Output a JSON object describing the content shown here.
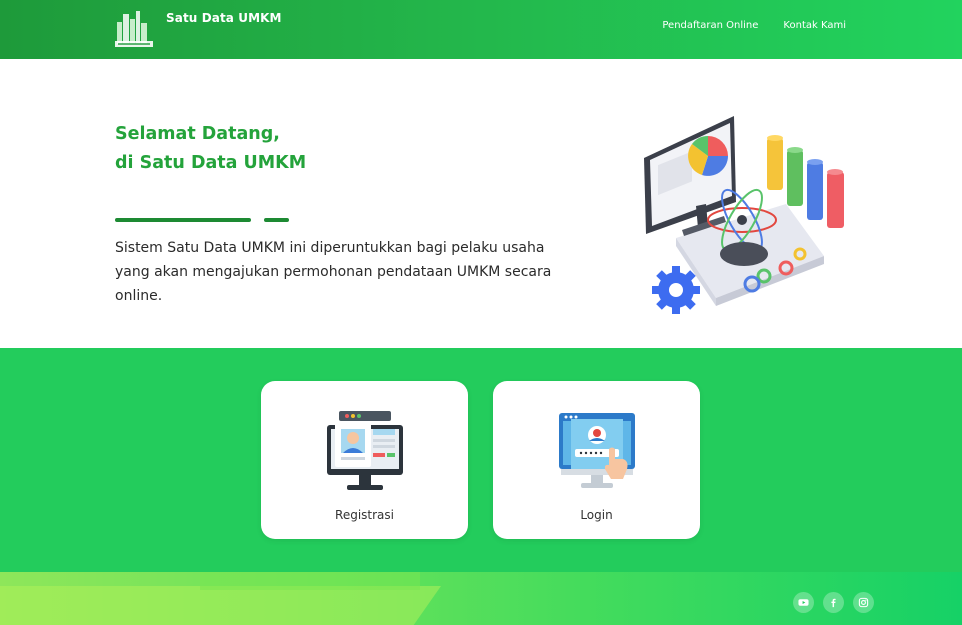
{
  "header": {
    "brand": "Satu Data UMKM",
    "nav": [
      "Pendaftaran Online",
      "Kontak Kami"
    ]
  },
  "hero": {
    "title_line1": "Selamat Datang,",
    "title_line2": "di Satu Data UMKM",
    "description": "Sistem Satu Data UMKM ini diperuntukkan bagi pelaku usaha yang akan mengajukan permohonan pendataan UMKM secara online."
  },
  "cards": [
    {
      "label": "Registrasi",
      "icon": "registration-monitor-icon"
    },
    {
      "label": "Login",
      "icon": "login-screen-icon"
    }
  ],
  "footer": {
    "socials": [
      "youtube-icon",
      "facebook-icon",
      "instagram-icon"
    ]
  },
  "colors": {
    "header_start": "#1e9a3a",
    "header_end": "#22d35e",
    "accent_title": "#24a33b",
    "band": "#23cc5c"
  }
}
